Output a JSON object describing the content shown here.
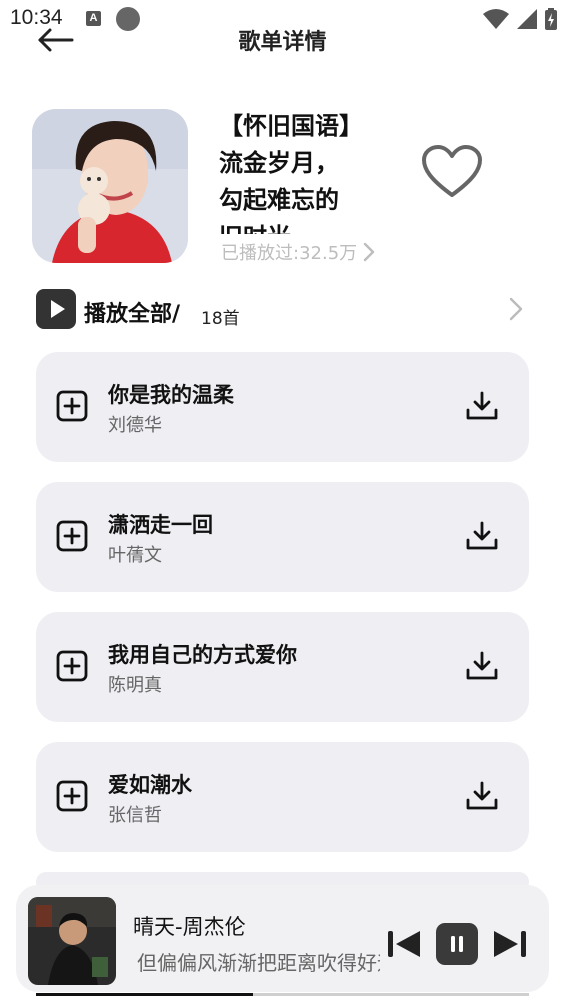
{
  "status_bar": {
    "time": "10:34",
    "notification_icon_letter": "A"
  },
  "header": {
    "title": "歌单详情",
    "back_icon": "arrow-left-icon"
  },
  "playlist": {
    "title": "【怀旧国语】流金岁月，勾起难忘的旧时光",
    "play_count": "已播放过:32.5万",
    "favorite_icon": "heart-outline-icon"
  },
  "play_all": {
    "label": "播放全部/",
    "count": "18首"
  },
  "songs": [
    {
      "title": "你是我的温柔",
      "artist": "刘德华"
    },
    {
      "title": "潇洒走一回",
      "artist": "叶蒨文"
    },
    {
      "title": "我用自己的方式爱你",
      "artist": "陈明真"
    },
    {
      "title": "爱如潮水",
      "artist": "张信哲"
    }
  ],
  "player": {
    "song": "晴天-周杰伦",
    "lyric": "但偏偏风渐渐把距离吹得好远",
    "progress": 0.44
  },
  "colors": {
    "card_background": "#eeeef3",
    "player_background": "#f1f1f4",
    "muted_text": "#bdbdbd",
    "dark_button": "#333333"
  }
}
